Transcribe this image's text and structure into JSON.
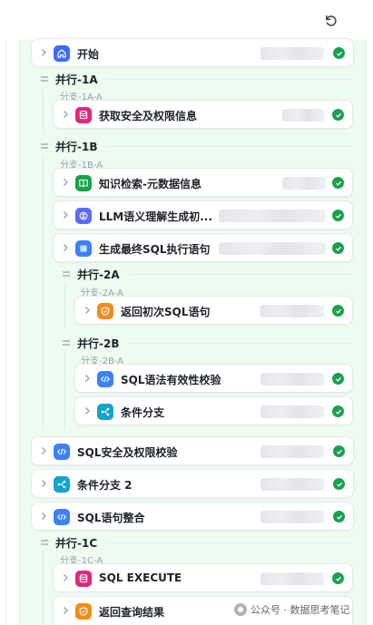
{
  "colors": {
    "panel": "#eefbf1",
    "success": "#1aa14e",
    "start": "#3b6cf6",
    "database": "#e2267d",
    "knowledge": "#17a34a",
    "llm": "#5b6cf3",
    "sqlgen": "#3b82f6",
    "output": "#f08c1a",
    "code": "#3b82f6",
    "condition": "#12a5c9"
  },
  "nodes": {
    "start": {
      "label": "开始",
      "icon": "home-icon"
    },
    "fetch_security": {
      "label": "获取安全及权限信息",
      "icon": "database-icon"
    },
    "knowledge_search": {
      "label": "知识检索-元数据信息",
      "icon": "book-icon"
    },
    "llm_understand": {
      "label": "LLM语义理解生成初...",
      "icon": "brain-icon"
    },
    "gen_final_sql": {
      "label": "生成最终SQL执行语句",
      "icon": "grid-icon"
    },
    "return_initial_sql": {
      "label": "返回初次SQL语句",
      "icon": "shield-icon"
    },
    "sql_syntax_check": {
      "label": "SQL语法有效性校验",
      "icon": "code-icon"
    },
    "condition_branch": {
      "label": "条件分支",
      "icon": "branch-icon"
    },
    "sql_security_check": {
      "label": "SQL安全及权限校验",
      "icon": "code-icon"
    },
    "condition_branch_2": {
      "label": "条件分支 2",
      "icon": "branch-icon"
    },
    "sql_merge": {
      "label": "SQL语句整合",
      "icon": "code-icon"
    },
    "sql_execute": {
      "label": "SQL EXECUTE",
      "icon": "database-icon"
    },
    "return_query_result": {
      "label": "返回查询结果",
      "icon": "shield-icon"
    }
  },
  "groups": {
    "p1a": {
      "title": "并行-1A",
      "branch": "分支-1A-A"
    },
    "p1b": {
      "title": "并行-1B",
      "branch": "分支-1B-A"
    },
    "p2a": {
      "title": "并行-2A",
      "branch": "分支-2A-A"
    },
    "p2b": {
      "title": "并行-2B",
      "branch": "分支-2B-A"
    },
    "p1c": {
      "title": "并行-1C",
      "branch": "分支-1C-A"
    }
  },
  "watermark": {
    "text": "公众号 · 数据思考笔记"
  }
}
